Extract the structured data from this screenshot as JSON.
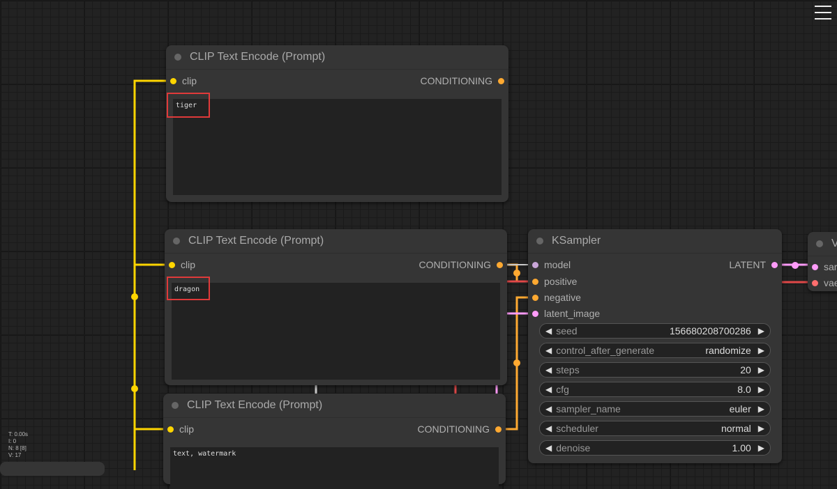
{
  "menu": {
    "icon": "hamburger-menu-icon"
  },
  "stats": [
    "T: 0.00s",
    "I: 0",
    "N: 8 [8]",
    "V: 17"
  ],
  "nodes": [
    {
      "title": "CLIP Text Encode (Prompt)",
      "input": "clip",
      "output": "CONDITIONING",
      "text": "tiger",
      "highlighted": true
    },
    {
      "title": "CLIP Text Encode (Prompt)",
      "input": "clip",
      "output": "CONDITIONING",
      "text": "dragon",
      "highlighted": true
    },
    {
      "title": "CLIP Text Encode (Prompt)",
      "input": "clip",
      "output": "CONDITIONING",
      "text": "text, watermark",
      "highlighted": false
    }
  ],
  "ksampler": {
    "title": "KSampler",
    "inputs": [
      "model",
      "positive",
      "negative",
      "latent_image"
    ],
    "output": "LATENT",
    "widgets": [
      {
        "label": "seed",
        "value": "156680208700286"
      },
      {
        "label": "control_after_generate",
        "value": "randomize"
      },
      {
        "label": "steps",
        "value": "20"
      },
      {
        "label": "cfg",
        "value": "8.0"
      },
      {
        "label": "sampler_name",
        "value": "euler"
      },
      {
        "label": "scheduler",
        "value": "normal"
      },
      {
        "label": "denoise",
        "value": "1.00"
      }
    ]
  },
  "vae_node": {
    "title": "V",
    "inputs": [
      "sar",
      "vae"
    ]
  },
  "colors": {
    "clip": "#ffd500",
    "conditioning": "#ffa931",
    "latent": "#ff9cf9",
    "vae": "#ff6e6e",
    "model": "#b39ddb",
    "highlight": "#e03a3a"
  }
}
